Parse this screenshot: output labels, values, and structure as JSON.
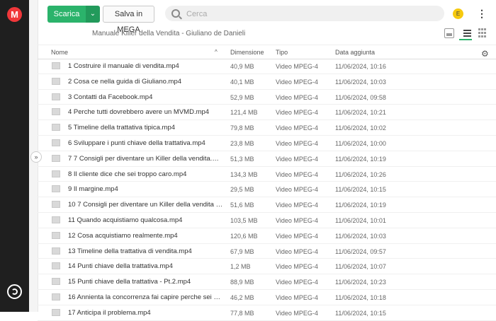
{
  "app": {
    "logo_letter": "M"
  },
  "toolbar": {
    "download_label": "Scarica",
    "save_label": "Salva in MEGA"
  },
  "search": {
    "placeholder": "Cerca"
  },
  "user": {
    "avatar_letter": "E"
  },
  "breadcrumb": "Manuale Killer della Vendita - Giuliano de Danieli",
  "columns": {
    "name": "Nome",
    "size": "Dimensione",
    "type": "Tipo",
    "date": "Data aggiunta"
  },
  "files": [
    {
      "name": "1 Costruire il manuale di vendita.mp4",
      "size": "40,9 MB",
      "type": "Video MPEG-4",
      "date": "11/06/2024, 10:16"
    },
    {
      "name": "2 Cosa ce nella guida di Giuliano.mp4",
      "size": "40,1 MB",
      "type": "Video MPEG-4",
      "date": "11/06/2024, 10:03"
    },
    {
      "name": "3 Contatti da Facebook.mp4",
      "size": "52,9 MB",
      "type": "Video MPEG-4",
      "date": "11/06/2024, 09:58"
    },
    {
      "name": "4 Perche tutti dovrebbero avere un MVMD.mp4",
      "size": "121,4 MB",
      "type": "Video MPEG-4",
      "date": "11/06/2024, 10:21"
    },
    {
      "name": "5 Timeline della trattativa tipica.mp4",
      "size": "79,8 MB",
      "type": "Video MPEG-4",
      "date": "11/06/2024, 10:02"
    },
    {
      "name": "6 Sviluppare i punti chiave della trattativa.mp4",
      "size": "23,8 MB",
      "type": "Video MPEG-4",
      "date": "11/06/2024, 10:00"
    },
    {
      "name": "7 7 Consigli per diventare un Killer della vendita.mp4",
      "size": "51,3 MB",
      "type": "Video MPEG-4",
      "date": "11/06/2024, 10:19"
    },
    {
      "name": "8 Il cliente dice che sei troppo caro.mp4",
      "size": "134,3 MB",
      "type": "Video MPEG-4",
      "date": "11/06/2024, 10:26"
    },
    {
      "name": "9 Il margine.mp4",
      "size": "29,5 MB",
      "type": "Video MPEG-4",
      "date": "11/06/2024, 10:15"
    },
    {
      "name": "10 7 Consigli per diventare un Killer della vendita - P...",
      "size": "51,6 MB",
      "type": "Video MPEG-4",
      "date": "11/06/2024, 10:19"
    },
    {
      "name": "11 Quando acquistiamo qualcosa.mp4",
      "size": "103,5 MB",
      "type": "Video MPEG-4",
      "date": "11/06/2024, 10:01"
    },
    {
      "name": "12 Cosa acquistiamo realmente.mp4",
      "size": "120,6 MB",
      "type": "Video MPEG-4",
      "date": "11/06/2024, 10:03"
    },
    {
      "name": "13 Timeline della trattativa di vendita.mp4",
      "size": "67,9 MB",
      "type": "Video MPEG-4",
      "date": "11/06/2024, 09:57"
    },
    {
      "name": "14 Punti chiave della trattativa.mp4",
      "size": "1,2 MB",
      "type": "Video MPEG-4",
      "date": "11/06/2024, 10:07"
    },
    {
      "name": "15 Punti chiave della trattativa - Pt.2.mp4",
      "size": "88,9 MB",
      "type": "Video MPEG-4",
      "date": "11/06/2024, 10:23"
    },
    {
      "name": "16 Annienta la concorrenza fai capire perche sei dive...",
      "size": "46,2 MB",
      "type": "Video MPEG-4",
      "date": "11/06/2024, 10:18"
    },
    {
      "name": "17 Anticipa il problema.mp4",
      "size": "77,8 MB",
      "type": "Video MPEG-4",
      "date": "11/06/2024, 10:15"
    }
  ]
}
